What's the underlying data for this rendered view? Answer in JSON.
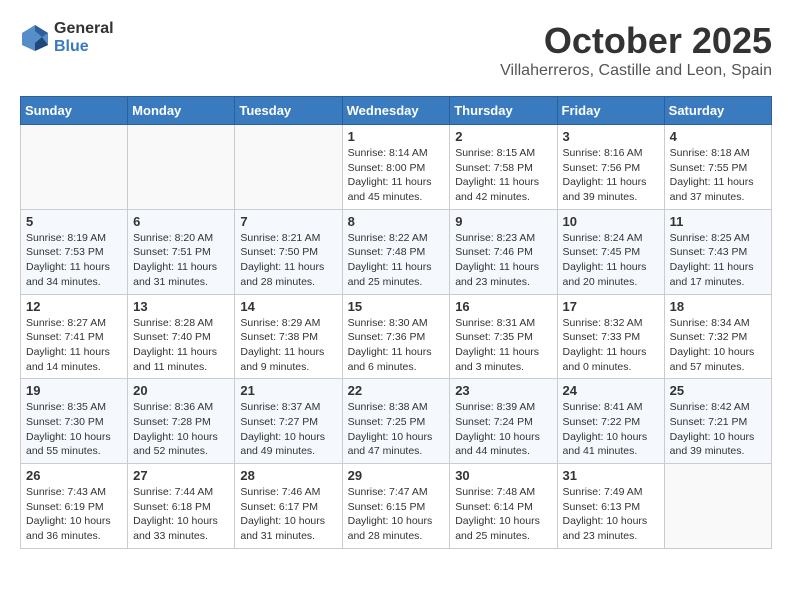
{
  "header": {
    "logo_general": "General",
    "logo_blue": "Blue",
    "month_title": "October 2025",
    "location": "Villaherreros, Castille and Leon, Spain"
  },
  "days_of_week": [
    "Sunday",
    "Monday",
    "Tuesday",
    "Wednesday",
    "Thursday",
    "Friday",
    "Saturday"
  ],
  "weeks": [
    [
      {
        "day": "",
        "info": ""
      },
      {
        "day": "",
        "info": ""
      },
      {
        "day": "",
        "info": ""
      },
      {
        "day": "1",
        "info": "Sunrise: 8:14 AM\nSunset: 8:00 PM\nDaylight: 11 hours and 45 minutes."
      },
      {
        "day": "2",
        "info": "Sunrise: 8:15 AM\nSunset: 7:58 PM\nDaylight: 11 hours and 42 minutes."
      },
      {
        "day": "3",
        "info": "Sunrise: 8:16 AM\nSunset: 7:56 PM\nDaylight: 11 hours and 39 minutes."
      },
      {
        "day": "4",
        "info": "Sunrise: 8:18 AM\nSunset: 7:55 PM\nDaylight: 11 hours and 37 minutes."
      }
    ],
    [
      {
        "day": "5",
        "info": "Sunrise: 8:19 AM\nSunset: 7:53 PM\nDaylight: 11 hours and 34 minutes."
      },
      {
        "day": "6",
        "info": "Sunrise: 8:20 AM\nSunset: 7:51 PM\nDaylight: 11 hours and 31 minutes."
      },
      {
        "day": "7",
        "info": "Sunrise: 8:21 AM\nSunset: 7:50 PM\nDaylight: 11 hours and 28 minutes."
      },
      {
        "day": "8",
        "info": "Sunrise: 8:22 AM\nSunset: 7:48 PM\nDaylight: 11 hours and 25 minutes."
      },
      {
        "day": "9",
        "info": "Sunrise: 8:23 AM\nSunset: 7:46 PM\nDaylight: 11 hours and 23 minutes."
      },
      {
        "day": "10",
        "info": "Sunrise: 8:24 AM\nSunset: 7:45 PM\nDaylight: 11 hours and 20 minutes."
      },
      {
        "day": "11",
        "info": "Sunrise: 8:25 AM\nSunset: 7:43 PM\nDaylight: 11 hours and 17 minutes."
      }
    ],
    [
      {
        "day": "12",
        "info": "Sunrise: 8:27 AM\nSunset: 7:41 PM\nDaylight: 11 hours and 14 minutes."
      },
      {
        "day": "13",
        "info": "Sunrise: 8:28 AM\nSunset: 7:40 PM\nDaylight: 11 hours and 11 minutes."
      },
      {
        "day": "14",
        "info": "Sunrise: 8:29 AM\nSunset: 7:38 PM\nDaylight: 11 hours and 9 minutes."
      },
      {
        "day": "15",
        "info": "Sunrise: 8:30 AM\nSunset: 7:36 PM\nDaylight: 11 hours and 6 minutes."
      },
      {
        "day": "16",
        "info": "Sunrise: 8:31 AM\nSunset: 7:35 PM\nDaylight: 11 hours and 3 minutes."
      },
      {
        "day": "17",
        "info": "Sunrise: 8:32 AM\nSunset: 7:33 PM\nDaylight: 11 hours and 0 minutes."
      },
      {
        "day": "18",
        "info": "Sunrise: 8:34 AM\nSunset: 7:32 PM\nDaylight: 10 hours and 57 minutes."
      }
    ],
    [
      {
        "day": "19",
        "info": "Sunrise: 8:35 AM\nSunset: 7:30 PM\nDaylight: 10 hours and 55 minutes."
      },
      {
        "day": "20",
        "info": "Sunrise: 8:36 AM\nSunset: 7:28 PM\nDaylight: 10 hours and 52 minutes."
      },
      {
        "day": "21",
        "info": "Sunrise: 8:37 AM\nSunset: 7:27 PM\nDaylight: 10 hours and 49 minutes."
      },
      {
        "day": "22",
        "info": "Sunrise: 8:38 AM\nSunset: 7:25 PM\nDaylight: 10 hours and 47 minutes."
      },
      {
        "day": "23",
        "info": "Sunrise: 8:39 AM\nSunset: 7:24 PM\nDaylight: 10 hours and 44 minutes."
      },
      {
        "day": "24",
        "info": "Sunrise: 8:41 AM\nSunset: 7:22 PM\nDaylight: 10 hours and 41 minutes."
      },
      {
        "day": "25",
        "info": "Sunrise: 8:42 AM\nSunset: 7:21 PM\nDaylight: 10 hours and 39 minutes."
      }
    ],
    [
      {
        "day": "26",
        "info": "Sunrise: 7:43 AM\nSunset: 6:19 PM\nDaylight: 10 hours and 36 minutes."
      },
      {
        "day": "27",
        "info": "Sunrise: 7:44 AM\nSunset: 6:18 PM\nDaylight: 10 hours and 33 minutes."
      },
      {
        "day": "28",
        "info": "Sunrise: 7:46 AM\nSunset: 6:17 PM\nDaylight: 10 hours and 31 minutes."
      },
      {
        "day": "29",
        "info": "Sunrise: 7:47 AM\nSunset: 6:15 PM\nDaylight: 10 hours and 28 minutes."
      },
      {
        "day": "30",
        "info": "Sunrise: 7:48 AM\nSunset: 6:14 PM\nDaylight: 10 hours and 25 minutes."
      },
      {
        "day": "31",
        "info": "Sunrise: 7:49 AM\nSunset: 6:13 PM\nDaylight: 10 hours and 23 minutes."
      },
      {
        "day": "",
        "info": ""
      }
    ]
  ]
}
